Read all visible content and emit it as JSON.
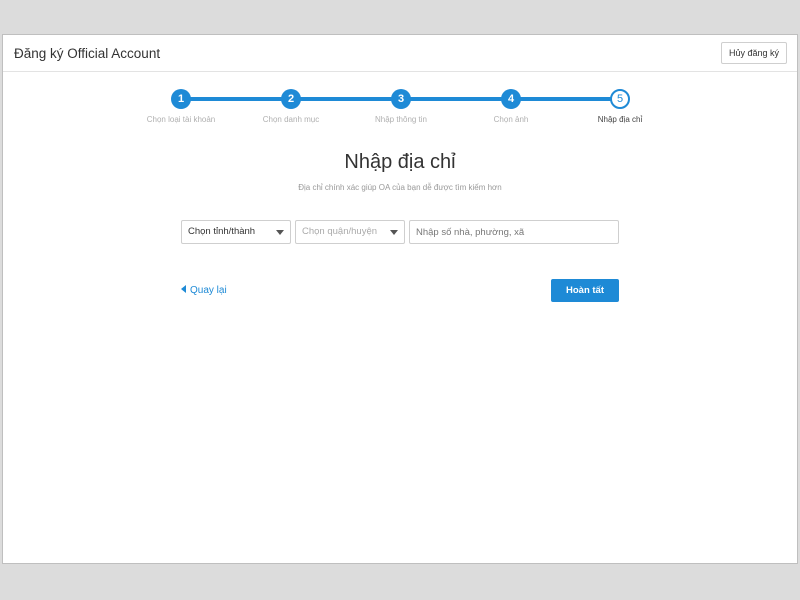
{
  "header": {
    "title": "Đăng ký Official Account",
    "cancel_label": "Hủy đăng ký"
  },
  "steps": [
    {
      "number": "1",
      "label": "Chọn loại tài khoản",
      "state": "done"
    },
    {
      "number": "2",
      "label": "Chọn danh mục",
      "state": "done"
    },
    {
      "number": "3",
      "label": "Nhập thông tin",
      "state": "done"
    },
    {
      "number": "4",
      "label": "Chọn ảnh",
      "state": "done"
    },
    {
      "number": "5",
      "label": "Nhập địa chỉ",
      "state": "current"
    }
  ],
  "main": {
    "title": "Nhập địa chỉ",
    "subtitle": "Địa chỉ chính xác giúp OA của bạn dễ được tìm kiếm hơn",
    "province_select": "Chọn tỉnh/thành",
    "district_select": "Chọn quận/huyện",
    "address_placeholder": "Nhập số nhà, phường, xã",
    "address_value": ""
  },
  "footer": {
    "back_label": "Quay lại",
    "finish_label": "Hoàn tất"
  },
  "colors": {
    "accent": "#1e8ad6"
  }
}
